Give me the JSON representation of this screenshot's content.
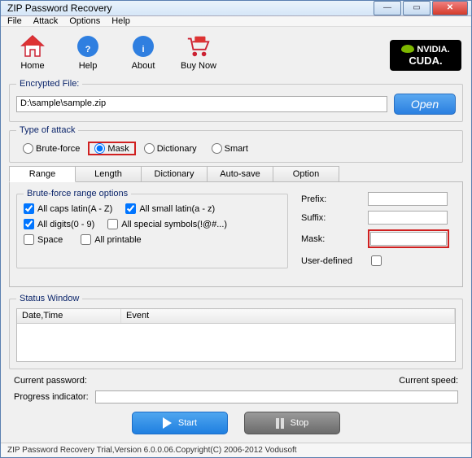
{
  "title": "ZIP Password Recovery",
  "menu": {
    "file": "File",
    "attack": "Attack",
    "options": "Options",
    "help": "Help"
  },
  "toolbar": {
    "home": "Home",
    "help": "Help",
    "about": "About",
    "buynow": "Buy Now",
    "nvidia": "NVIDIA.",
    "cuda": "CUDA."
  },
  "encfile": {
    "legend": "Encrypted File:",
    "path": "D:\\sample\\sample.zip",
    "open": "Open"
  },
  "attacktype": {
    "legend": "Type of attack",
    "brute": "Brute-force",
    "mask": "Mask",
    "dict": "Dictionary",
    "smart": "Smart",
    "selected": "mask"
  },
  "tabs": {
    "range": "Range",
    "length": "Length",
    "dict": "Dictionary",
    "autosave": "Auto-save",
    "option": "Option"
  },
  "range": {
    "legend": "Brute-force range options",
    "caps": "All caps latin(A - Z)",
    "small": "All small latin(a - z)",
    "digits": "All digits(0 - 9)",
    "special": "All special symbols(!@#...)",
    "space": "Space",
    "printable": "All printable",
    "prefix": "Prefix:",
    "suffix": "Suffix:",
    "mask": "Mask:",
    "userdef": "User-defined",
    "prefix_val": "",
    "suffix_val": "",
    "mask_val": ""
  },
  "status": {
    "legend": "Status Window",
    "col_date": "Date,Time",
    "col_event": "Event"
  },
  "bottom": {
    "curpass": "Current password:",
    "curspeed": "Current speed:",
    "progress": "Progress indicator:",
    "start": "Start",
    "stop": "Stop"
  },
  "footer": "ZIP Password Recovery Trial,Version 6.0.0.06.Copyright(C) 2006-2012 Vodusoft"
}
